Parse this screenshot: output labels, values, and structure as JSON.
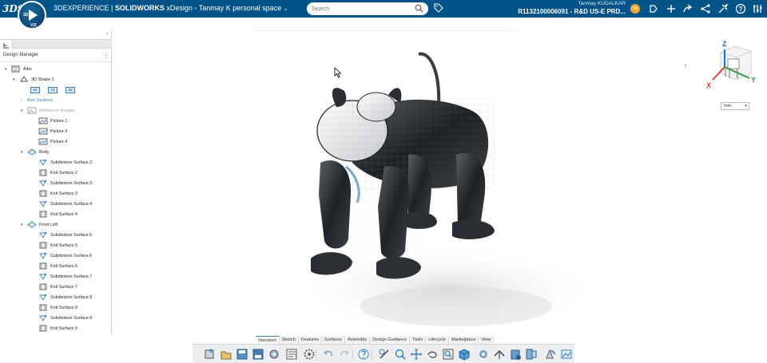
{
  "topbar": {
    "logo": "3DS",
    "compass_label_left": "3D",
    "compass_label_bottom": "V,R",
    "brand_prefix": "3DEXPERIENCE | ",
    "brand_product": "SOLIDWORKS",
    "brand_app": " xDesign - Tanmay K personal space",
    "brand_chevron": "⌄",
    "search_placeholder": "Search",
    "user_name": "Tanmay KUDALKAR",
    "user_role": "R1132100006091 - R&D US-E PRD...",
    "avatar_initials": "TK",
    "icons": [
      "share-icon",
      "add-icon",
      "share-network-icon",
      "tools-icon",
      "help-icon",
      "menu-icon"
    ]
  },
  "left_panel": {
    "collapse_label": "‹",
    "title": "Design Manager",
    "kebab": "⋮",
    "tree": [
      {
        "label": "Aibo",
        "level": 0,
        "arrow": "▾",
        "icon": "assembly-icon",
        "style": "normal"
      },
      {
        "label": "3D Shape 1",
        "level": 1,
        "arrow": "▾",
        "icon": "shape-icon",
        "style": "normal"
      },
      {
        "label": "Axis Systems",
        "level": 2,
        "arrow": "›",
        "icon": "",
        "style": "blue"
      },
      {
        "label": "Reference Images",
        "level": 2,
        "arrow": "▾",
        "icon": "image-set-icon",
        "style": "muted"
      },
      {
        "label": "Picture 1",
        "level": 3,
        "arrow": "",
        "icon": "picture-icon",
        "style": "normal"
      },
      {
        "label": "Picture 3",
        "level": 3,
        "arrow": "",
        "icon": "picture-icon",
        "style": "normal"
      },
      {
        "label": "Picture 4",
        "level": 3,
        "arrow": "",
        "icon": "picture-icon",
        "style": "normal"
      },
      {
        "label": "Body",
        "level": 2,
        "arrow": "▾",
        "icon": "body-icon",
        "style": "normal"
      },
      {
        "label": "Subdivision Surface.2",
        "level": 3,
        "arrow": "",
        "icon": "subdivision-icon",
        "style": "normal"
      },
      {
        "label": "Knit Surface 2",
        "level": 3,
        "arrow": "",
        "icon": "knit-icon",
        "style": "normal"
      },
      {
        "label": "Subdivision Surface.3",
        "level": 3,
        "arrow": "",
        "icon": "subdivision-icon",
        "style": "normal"
      },
      {
        "label": "Knit Surface 3",
        "level": 3,
        "arrow": "",
        "icon": "knit-icon",
        "style": "normal"
      },
      {
        "label": "Subdivision Surface.4",
        "level": 3,
        "arrow": "",
        "icon": "subdivision-icon",
        "style": "normal"
      },
      {
        "label": "Knit Surface 4",
        "level": 3,
        "arrow": "",
        "icon": "knit-icon",
        "style": "normal"
      },
      {
        "label": "Front Left",
        "level": 2,
        "arrow": "▾",
        "icon": "body-icon",
        "style": "normal"
      },
      {
        "label": "Subdivision Surface.5",
        "level": 3,
        "arrow": "",
        "icon": "subdivision-icon",
        "style": "normal"
      },
      {
        "label": "Knit Surface 5",
        "level": 3,
        "arrow": "",
        "icon": "knit-icon",
        "style": "normal"
      },
      {
        "label": "Subdivision Surface.6",
        "level": 3,
        "arrow": "",
        "icon": "subdivision-icon",
        "style": "normal"
      },
      {
        "label": "Knit Surface.6",
        "level": 3,
        "arrow": "",
        "icon": "knit-icon",
        "style": "normal"
      },
      {
        "label": "Subdivision Surface.7",
        "level": 3,
        "arrow": "",
        "icon": "subdivision-icon",
        "style": "normal"
      },
      {
        "label": "Knit Surface 7",
        "level": 3,
        "arrow": "",
        "icon": "knit-icon",
        "style": "normal"
      },
      {
        "label": "Subdivision Surface.8",
        "level": 3,
        "arrow": "",
        "icon": "subdivision-icon",
        "style": "normal"
      },
      {
        "label": "Knit Surface 8",
        "level": 3,
        "arrow": "",
        "icon": "knit-icon",
        "style": "normal"
      },
      {
        "label": "Subdivision Surface.9",
        "level": 3,
        "arrow": "",
        "icon": "subdivision-icon",
        "style": "normal"
      },
      {
        "label": "Knit Surface 9",
        "level": 3,
        "arrow": "",
        "icon": "knit-icon",
        "style": "normal"
      }
    ],
    "plane_labels": [
      "XY",
      "YZ",
      "ZX"
    ]
  },
  "viewport": {
    "nav_chevron": "‹",
    "triad_labels": {
      "z": "Z",
      "y": "Y",
      "x": "X"
    },
    "unit_value": "mm",
    "unit_dropdown": "▾"
  },
  "action_bar": {
    "tabs": [
      "Standard",
      "Sketch",
      "Features",
      "Surfaces",
      "Assembly",
      "Design Guidance",
      "Tools",
      "Lifecycle",
      "Marketplace",
      "View"
    ],
    "active_tab": "Standard"
  },
  "colors": {
    "topbar": "#005386",
    "accent": "#3a7fc0",
    "triad_x": "#e53935",
    "triad_y": "#2e9a3a",
    "triad_z": "#1f6fc4"
  }
}
